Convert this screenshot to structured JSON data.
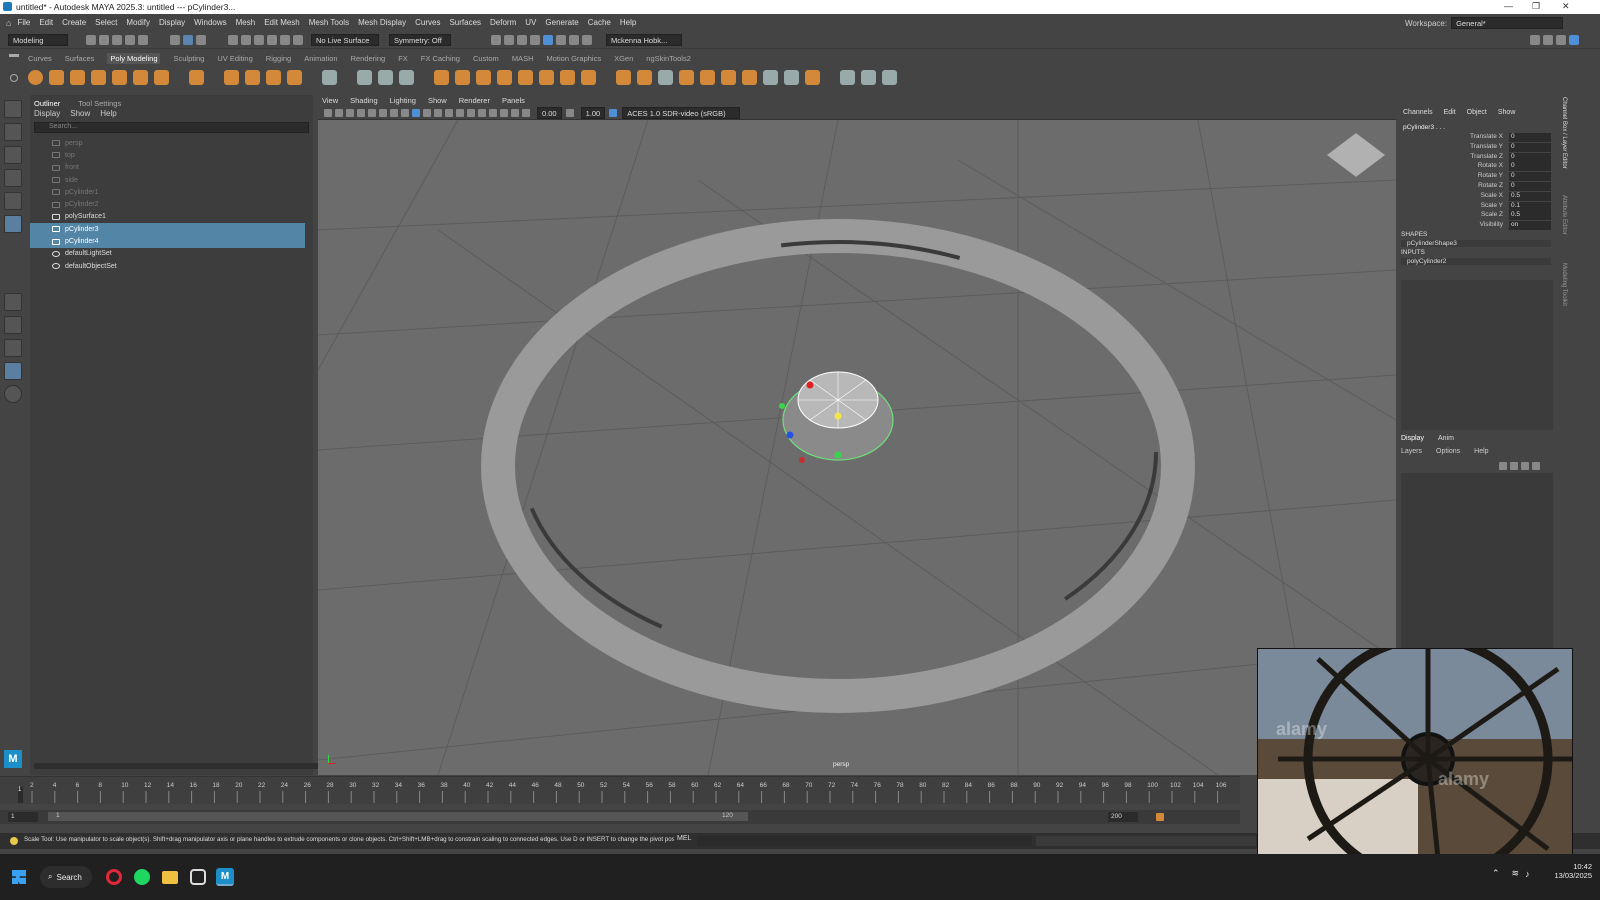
{
  "window": {
    "title": "untitled* - Autodesk MAYA 2025.3: untitled   ---   pCylinder3..."
  },
  "menu": [
    "File",
    "Edit",
    "Create",
    "Select",
    "Modify",
    "Display",
    "Windows",
    "Mesh",
    "Edit Mesh",
    "Mesh Tools",
    "Mesh Display",
    "Curves",
    "Surfaces",
    "Deform",
    "UV",
    "Generate",
    "Cache",
    "Help"
  ],
  "workspace": {
    "label": "Workspace:",
    "value": "General*"
  },
  "toolbar": {
    "mode": "Modeling",
    "live_surface": "No Live Surface",
    "symmetry": "Symmetry: Off",
    "user": "Mckenna Hobk..."
  },
  "shelf_tabs": [
    "Curves",
    "Surfaces",
    "Poly Modeling",
    "Sculpting",
    "UV Editing",
    "Rigging",
    "Animation",
    "Rendering",
    "FX",
    "FX Caching",
    "Custom",
    "MASH",
    "Motion Graphics",
    "XGen",
    "ngSkinTools2"
  ],
  "shelf_active": "Poly Modeling",
  "outliner": {
    "tabs": [
      "Outliner",
      "Tool Settings"
    ],
    "menu": [
      "Display",
      "Show",
      "Help"
    ],
    "search_placeholder": "Search...",
    "items": [
      {
        "label": "persp",
        "kind": "camera",
        "dim": true,
        "selected": false
      },
      {
        "label": "top",
        "kind": "camera",
        "dim": true,
        "selected": false
      },
      {
        "label": "front",
        "kind": "camera",
        "dim": true,
        "selected": false
      },
      {
        "label": "side",
        "kind": "camera",
        "dim": true,
        "selected": false
      },
      {
        "label": "pCylinder1",
        "kind": "mesh",
        "dim": true,
        "selected": false
      },
      {
        "label": "pCylinder2",
        "kind": "mesh",
        "dim": true,
        "selected": false
      },
      {
        "label": "polySurface1",
        "kind": "mesh",
        "dim": false,
        "selected": false
      },
      {
        "label": "pCylinder3",
        "kind": "mesh",
        "dim": false,
        "selected": true
      },
      {
        "label": "pCylinder4",
        "kind": "mesh",
        "dim": false,
        "selected": true
      },
      {
        "label": "defaultLightSet",
        "kind": "set",
        "dim": false,
        "selected": false
      },
      {
        "label": "defaultObjectSet",
        "kind": "set",
        "dim": false,
        "selected": false
      }
    ]
  },
  "viewport": {
    "menu": [
      "View",
      "Shading",
      "Lighting",
      "Show",
      "Renderer",
      "Panels"
    ],
    "field_a": "0.00",
    "field_b": "1.00",
    "colorspace": "ACES 1.0 SDR-video (sRGB)",
    "camera": "persp"
  },
  "channel_box": {
    "menu": [
      "Channels",
      "Edit",
      "Object",
      "Show"
    ],
    "object": "pCylinder3 . . .",
    "attributes": [
      {
        "name": "Translate X",
        "value": "0"
      },
      {
        "name": "Translate Y",
        "value": "0"
      },
      {
        "name": "Translate Z",
        "value": "0"
      },
      {
        "name": "Rotate X",
        "value": "0"
      },
      {
        "name": "Rotate Y",
        "value": "0"
      },
      {
        "name": "Rotate Z",
        "value": "0"
      },
      {
        "name": "Scale X",
        "value": "0.5"
      },
      {
        "name": "Scale Y",
        "value": "0.1"
      },
      {
        "name": "Scale Z",
        "value": "0.5"
      },
      {
        "name": "Visibility",
        "value": "on"
      }
    ],
    "shapes_label": "SHAPES",
    "shape": "pCylinderShape3",
    "inputs_label": "INPUTS",
    "input": "polyCylinder2"
  },
  "layer_editor": {
    "tabs": [
      "Display",
      "Anim"
    ],
    "menu": [
      "Layers",
      "Options",
      "Help"
    ]
  },
  "side_tabs": [
    "Channel Box / Layer Editor",
    "Attribute Editor",
    "Modeling Toolkit"
  ],
  "timeline": {
    "ticks": [
      "2",
      "4",
      "6",
      "8",
      "10",
      "12",
      "14",
      "16",
      "18",
      "20",
      "22",
      "24",
      "26",
      "28",
      "30",
      "32",
      "34",
      "36",
      "38",
      "40",
      "42",
      "44",
      "46",
      "48",
      "50",
      "52",
      "54",
      "56",
      "58",
      "60",
      "62",
      "64",
      "66",
      "68",
      "70",
      "72",
      "74",
      "76",
      "78",
      "80",
      "82",
      "84",
      "86",
      "88",
      "90",
      "92",
      "94",
      "96",
      "98",
      "100",
      "102",
      "104",
      "106"
    ],
    "current": "1",
    "range_start": "1",
    "range_inner_start": "1",
    "range_inner_end": "120",
    "range_end": "200"
  },
  "status": {
    "help": "Scale Tool: Use manipulator to scale object(s). Shift+drag manipulator axis or plane handles to extrude components or clone objects. Ctrl+Shift+LMB+drag to constrain scaling to connected edges. Use D or INSERT to change the pivot posit",
    "mel": "MEL"
  },
  "taskbar": {
    "search": "Search",
    "time": "10:42",
    "date": "13/03/2025"
  },
  "video": {
    "watermark": "alamy"
  },
  "colors": {
    "selection": "#5285a6",
    "shelf_icon": "#d4893a",
    "viewport_bg": "#6c6c6c"
  }
}
